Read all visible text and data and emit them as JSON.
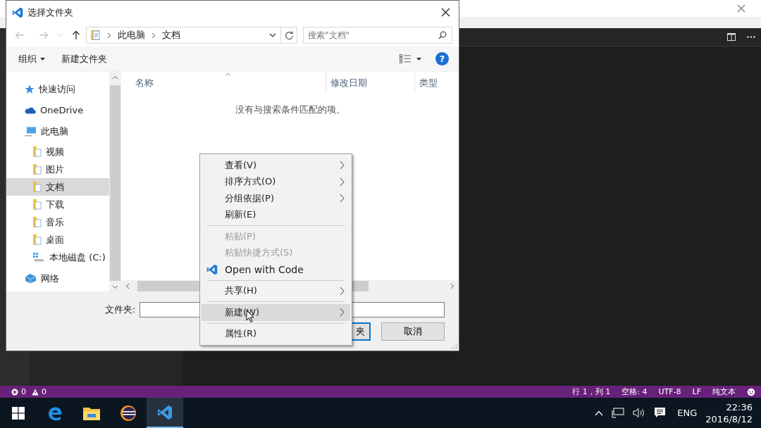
{
  "editor_window": {
    "status_bar": {
      "errors": "0",
      "warnings": "0",
      "items": [
        "行 1，列 1",
        "空格: 4",
        "UTF-8",
        "LF",
        "纯文本"
      ]
    }
  },
  "dialog": {
    "title": "选择文件夹",
    "breadcrumb": [
      "此电脑",
      "文档"
    ],
    "search": {
      "placeholder": "搜索\"文档\""
    },
    "toolbar": {
      "organize": "组织",
      "new_folder": "新建文件夹",
      "help": "?"
    },
    "nav": [
      {
        "label": "快速访问",
        "kind": "star",
        "selected": false
      },
      {
        "label": "OneDrive",
        "kind": "cloud",
        "selected": false
      },
      {
        "label": "此电脑",
        "kind": "computer",
        "selected": false,
        "children": [
          {
            "label": "视频",
            "kind": "folder",
            "selected": false
          },
          {
            "label": "图片",
            "kind": "folder",
            "selected": false
          },
          {
            "label": "文档",
            "kind": "folder",
            "selected": true
          },
          {
            "label": "下载",
            "kind": "folder",
            "selected": false
          },
          {
            "label": "音乐",
            "kind": "folder",
            "selected": false
          },
          {
            "label": "桌面",
            "kind": "folder",
            "selected": false
          },
          {
            "label": "本地磁盘 (C:)",
            "kind": "drive",
            "selected": false
          }
        ]
      },
      {
        "label": "网络",
        "kind": "network",
        "selected": false
      }
    ],
    "columns": [
      "名称",
      "修改日期",
      "类型"
    ],
    "empty_message": "没有与搜索条件匹配的项。",
    "folder_field": {
      "label": "文件夹:"
    },
    "buttons": [
      {
        "label": "夹",
        "kind": "primary"
      },
      {
        "label": "取消",
        "kind": "normal"
      }
    ]
  },
  "context_menu": {
    "items": [
      {
        "kind": "item",
        "label": "查看(V)",
        "submenu": true,
        "disabled": false,
        "selected": false
      },
      {
        "kind": "item",
        "label": "排序方式(O)",
        "submenu": true,
        "disabled": false,
        "selected": false
      },
      {
        "kind": "item",
        "label": "分组依据(P)",
        "submenu": true,
        "disabled": false,
        "selected": false
      },
      {
        "kind": "item",
        "label": "刷新(E)",
        "submenu": false,
        "disabled": false,
        "selected": false
      },
      {
        "kind": "separator"
      },
      {
        "kind": "item",
        "label": "粘贴(P)",
        "submenu": false,
        "disabled": true,
        "selected": false
      },
      {
        "kind": "item",
        "label": "粘贴快捷方式(S)",
        "submenu": false,
        "disabled": true,
        "selected": false
      },
      {
        "kind": "code",
        "label": "Open with Code",
        "submenu": false,
        "disabled": false,
        "selected": false
      },
      {
        "kind": "separator"
      },
      {
        "kind": "item",
        "label": "共享(H)",
        "submenu": true,
        "disabled": false,
        "selected": false
      },
      {
        "kind": "separator"
      },
      {
        "kind": "item",
        "label": "新建(W)",
        "submenu": true,
        "disabled": false,
        "selected": true
      },
      {
        "kind": "separator"
      },
      {
        "kind": "item",
        "label": "属性(R)",
        "submenu": false,
        "disabled": false,
        "selected": false
      }
    ]
  },
  "taskbar": {
    "apps": [
      {
        "kind": "windows",
        "selected": false
      },
      {
        "kind": "edge",
        "selected": false
      },
      {
        "kind": "explorer",
        "selected": false
      },
      {
        "kind": "eclipse",
        "selected": false
      },
      {
        "kind": "vscode",
        "selected": true
      }
    ],
    "language": "ENG",
    "time": "22:36",
    "date": "2016/8/12"
  }
}
